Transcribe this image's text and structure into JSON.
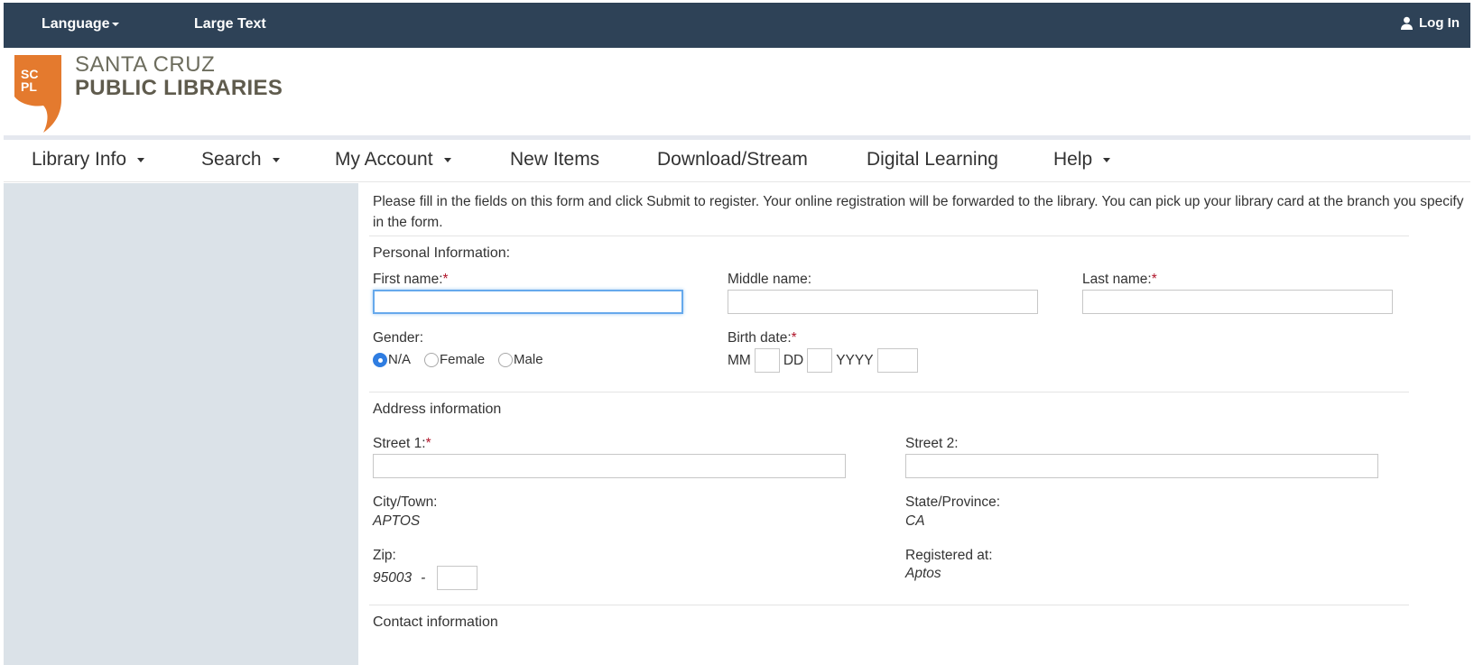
{
  "topbar": {
    "language_label": "Language",
    "large_text_label": "Large Text",
    "login_label": "Log In"
  },
  "logo": {
    "mark_text_top": "SC",
    "mark_text_bottom": "PL",
    "line1": "SANTA CRUZ",
    "line2": "PUBLIC LIBRARIES",
    "brand_color": "#e47a2e"
  },
  "nav": {
    "items": [
      {
        "label": "Library Info",
        "dropdown": true
      },
      {
        "label": "Search",
        "dropdown": true
      },
      {
        "label": "My Account",
        "dropdown": true
      },
      {
        "label": "New Items",
        "dropdown": false
      },
      {
        "label": "Download/Stream",
        "dropdown": false
      },
      {
        "label": "Digital Learning",
        "dropdown": false
      },
      {
        "label": "Help",
        "dropdown": true
      }
    ]
  },
  "form": {
    "intro": "Please fill in the fields on this form and click Submit to register. Your online registration will be forwarded to the library. You can pick up your library card at the branch you specify in the form.",
    "personal": {
      "title": "Personal Information:",
      "first_name_label": "First name:",
      "middle_name_label": "Middle name:",
      "last_name_label": "Last name:",
      "required_mark": "*",
      "gender_label": "Gender:",
      "gender_options": [
        "N/A",
        "Female",
        "Male"
      ],
      "gender_selected": "N/A",
      "birth_date_label": "Birth date:",
      "mm": "MM",
      "dd": "DD",
      "yyyy": "YYYY"
    },
    "address": {
      "title": "Address information",
      "street1_label": "Street 1:",
      "street2_label": "Street 2:",
      "city_label": "City/Town:",
      "city_value": "APTOS",
      "state_label": "State/Province:",
      "state_value": "CA",
      "zip_label": "Zip:",
      "zip_value": "95003",
      "zip_separator": "-",
      "registered_label": "Registered at:",
      "registered_value": "Aptos"
    },
    "contact": {
      "title": "Contact information"
    }
  },
  "colors": {
    "topbar_bg": "#2e4257",
    "sidebar_bg": "#dbe2e8",
    "required": "#b0152a",
    "radio_selected": "#2f7de1"
  }
}
